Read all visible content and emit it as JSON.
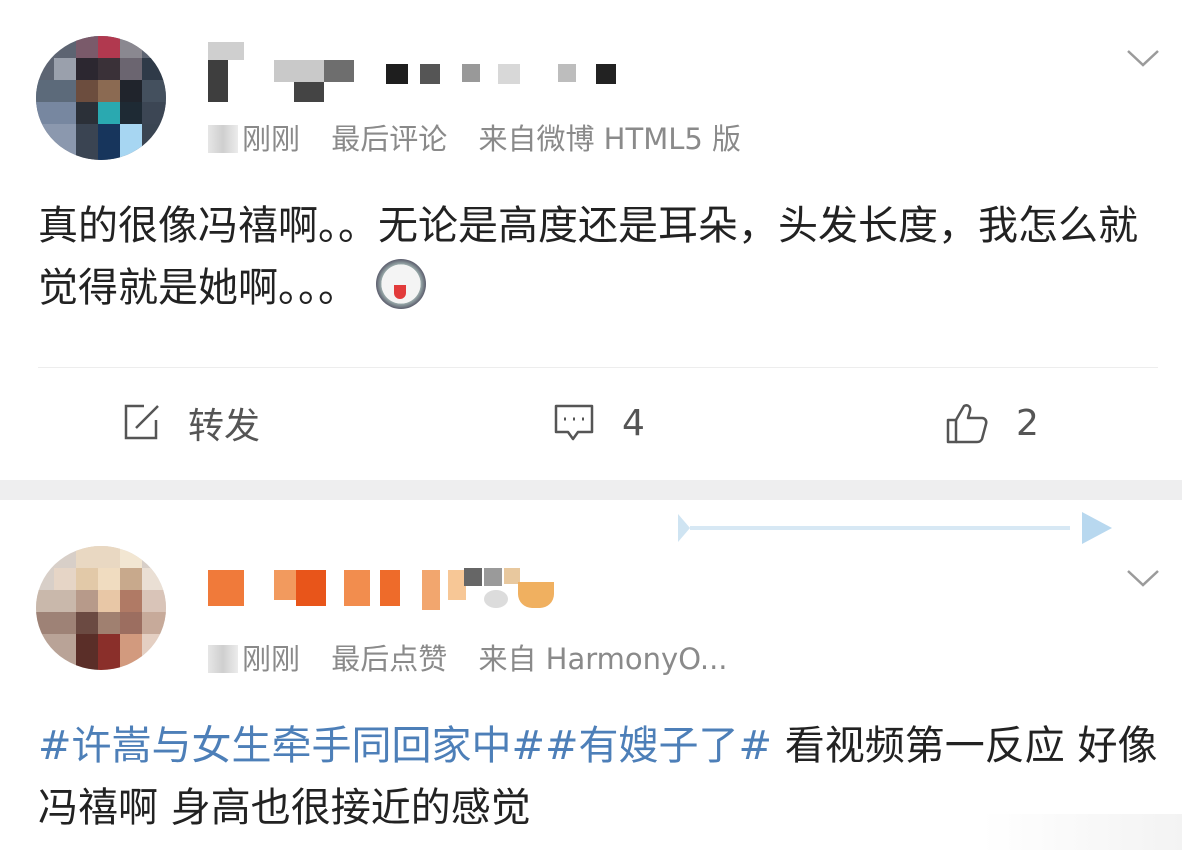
{
  "posts": [
    {
      "meta": {
        "time": "刚刚",
        "action": "最后评论",
        "source": "来自微博 HTML5 版"
      },
      "text": "真的很像冯禧啊。。无论是高度还是耳朵，头发长度，我怎么就觉得就是她啊。。。",
      "emoji": "laughing-face-emoji",
      "actions": {
        "repost_label": "转发",
        "comment_count": "4",
        "like_count": "2"
      }
    },
    {
      "meta": {
        "time": "刚刚",
        "action": "最后点赞",
        "source": "来自 HarmonyO..."
      },
      "topics": [
        "#许嵩与女生牵手同回家中#",
        "#有嫂子了#"
      ],
      "text": " 看视频第一反应 好像冯禧啊 身高也很接近的感觉"
    }
  ],
  "icons": [
    "more-chevron-icon",
    "repost-edit-icon",
    "comment-icon",
    "like-thumb-icon",
    "video-play-icon"
  ],
  "colors": {
    "topic": "#4d7fb8",
    "meta_text": "#8a8a8a",
    "body_text": "#222222",
    "divider": "#eeeeef"
  }
}
